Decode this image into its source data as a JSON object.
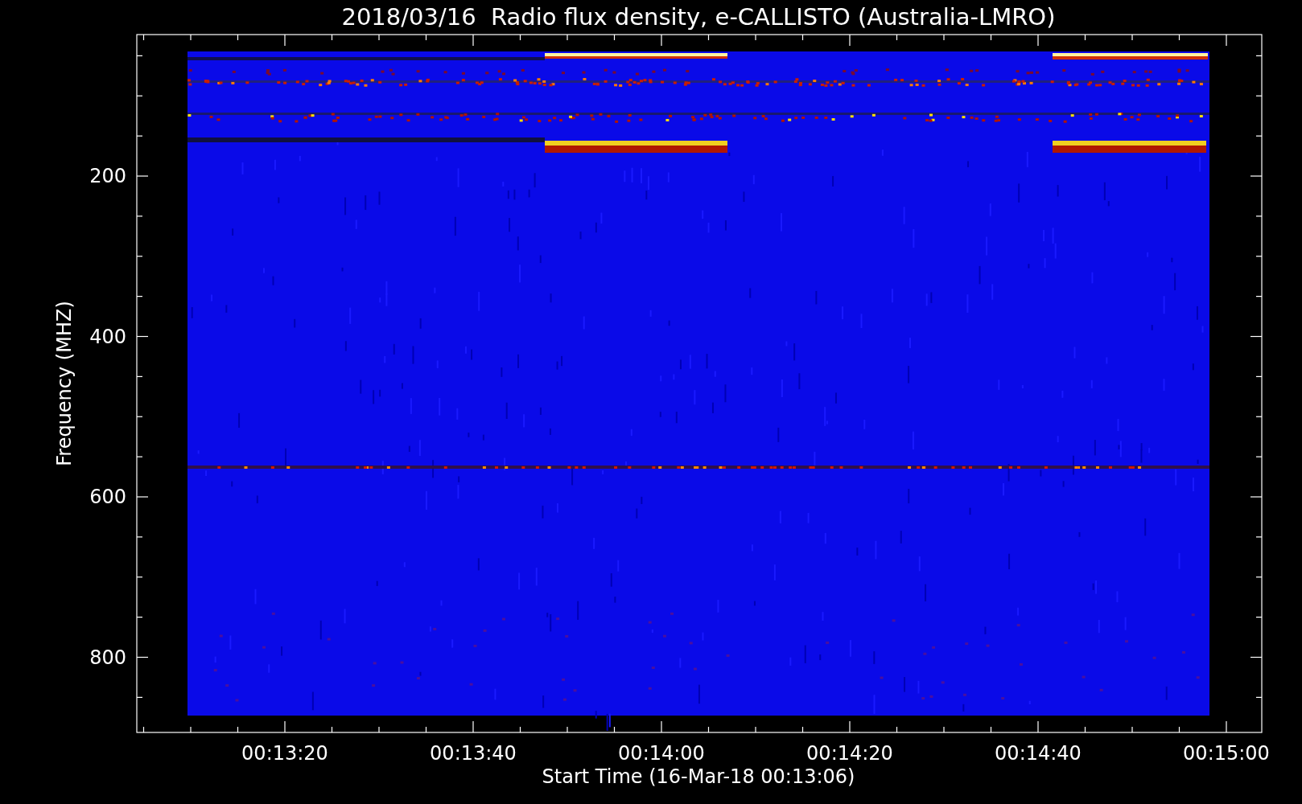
{
  "title": "2018/03/16  Radio flux density, e-CALLISTO (Australia-LMRO)",
  "y_axis": {
    "label": "Frequency (MHZ)",
    "ticks": [
      "200",
      "400",
      "600",
      "800"
    ]
  },
  "x_axis": {
    "label": "Start Time (16-Mar-18 00:13:06)",
    "ticks": [
      "00:13:20",
      "00:13:40",
      "00:14:00",
      "00:14:20",
      "00:14:40",
      "00:15:00"
    ]
  }
}
